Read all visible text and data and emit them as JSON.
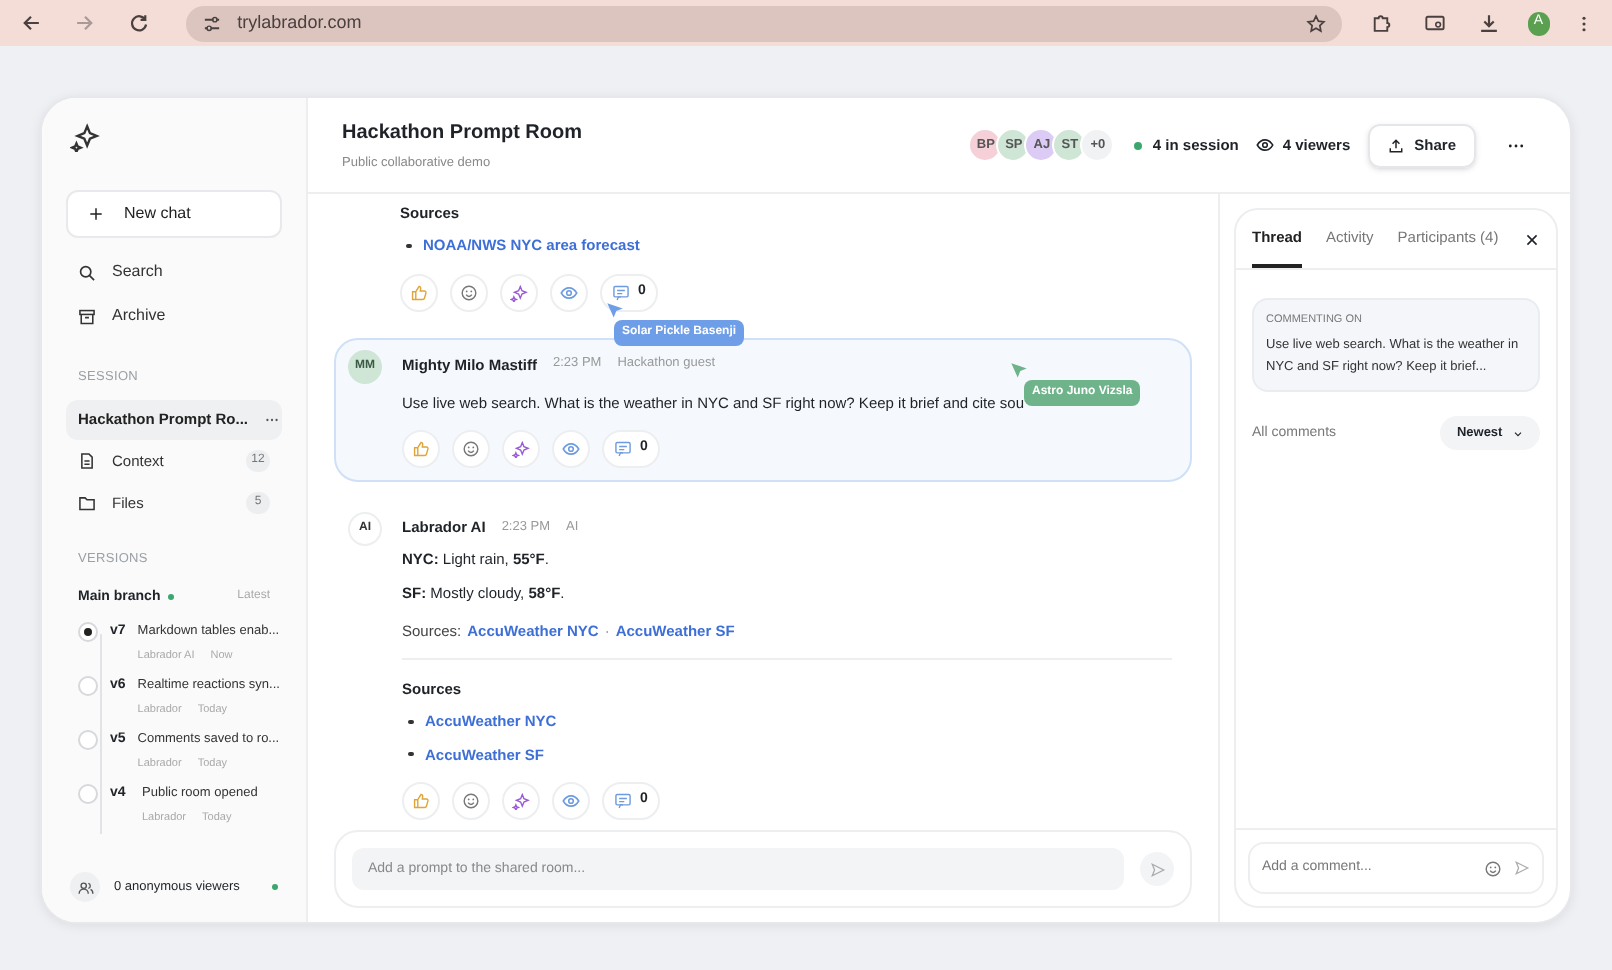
{
  "browser": {
    "url": "trylabrador.com",
    "profile": "A"
  },
  "sidebar": {
    "new_chat": "New chat",
    "nav": [
      {
        "kind": "search",
        "label": "Search"
      },
      {
        "kind": "archive",
        "label": "Archive"
      }
    ],
    "session_heading": "SESSION",
    "session_items": [
      {
        "kind": "room",
        "label": "Hackathon Prompt Ro...",
        "selected": true
      },
      {
        "kind": "context",
        "label": "Context",
        "count": "12",
        "selected": false
      },
      {
        "kind": "files",
        "label": "Files",
        "count": "5",
        "selected": false
      }
    ],
    "versions_heading": "VERSIONS",
    "branch": "Main branch",
    "branch_tag": "Latest",
    "versions": [
      {
        "version": "v7",
        "title": "Markdown tables enab...",
        "author": "Labrador AI",
        "time": "Now",
        "selected": true
      },
      {
        "version": "v6",
        "title": "Realtime reactions syn...",
        "author": "Labrador",
        "time": "Today",
        "selected": false
      },
      {
        "version": "v5",
        "title": "Comments saved to ro...",
        "author": "Labrador",
        "time": "Today",
        "selected": false
      },
      {
        "version": "v4",
        "title": "Public room opened",
        "author": "Labrador",
        "time": "Today",
        "selected": false
      }
    ],
    "viewers": "0 anonymous viewers"
  },
  "header": {
    "title": "Hackathon Prompt Room",
    "subtitle": "Public collaborative demo",
    "avatars": [
      {
        "initials": "BP",
        "color": "#f5d0d8"
      },
      {
        "initials": "SP",
        "color": "#cfe5d6"
      },
      {
        "initials": "AJ",
        "color": "#dccbf5"
      },
      {
        "initials": "ST",
        "color": "#cfe5d6"
      },
      {
        "initials": "+0",
        "color": "#f1f2f4"
      }
    ],
    "in_session": "4 in session",
    "viewers": "4 viewers",
    "share": "Share"
  },
  "messages": [
    {
      "kind": "partial",
      "sources_heading": "Sources",
      "sources": [
        "NOAA/NWS NYC area forecast"
      ],
      "comments": "0"
    },
    {
      "kind": "user",
      "avatar": "MM",
      "author": "Mighty Milo Mastiff",
      "time": "2:23 PM",
      "role": "Hackathon guest",
      "text": "Use live web search. What is the weather in NYC and SF right now? Keep it brief and cite sou",
      "comments": "0",
      "highlighted": true
    },
    {
      "kind": "ai",
      "highlighted": false,
      "avatar": "AI",
      "author": "Labrador AI",
      "time": "2:23 PM",
      "role": "AI",
      "lines": [
        "**NYC:** Light rain, **55°F**.",
        "**SF:** Mostly cloudy, **58°F**."
      ],
      "sources_label": "Sources:",
      "inline_sources": [
        "AccuWeather NYC",
        "AccuWeather SF"
      ],
      "separator": "·",
      "sources_heading": "Sources",
      "sources": [
        "AccuWeather NYC",
        "AccuWeather SF"
      ],
      "comments": "0"
    }
  ],
  "cursors": [
    {
      "name": "Solar Pickle Basenji",
      "color": "#6f9ee8"
    },
    {
      "name": "Astro Juno Vizsla",
      "color": "#6fb38a"
    }
  ],
  "composer": {
    "placeholder": "Add a prompt to the shared room..."
  },
  "panel": {
    "tabs": [
      {
        "label": "Thread",
        "selected": true
      },
      {
        "label": "Activity",
        "selected": false
      },
      {
        "label": "Participants (4)",
        "selected": false
      }
    ],
    "commenting_label": "COMMENTING ON",
    "commenting_text": "Use live web search. What is the weather in NYC and SF right now? Keep it brief...",
    "all_comments": "All comments",
    "sort": "Newest",
    "comment_placeholder": "Add a comment..."
  }
}
